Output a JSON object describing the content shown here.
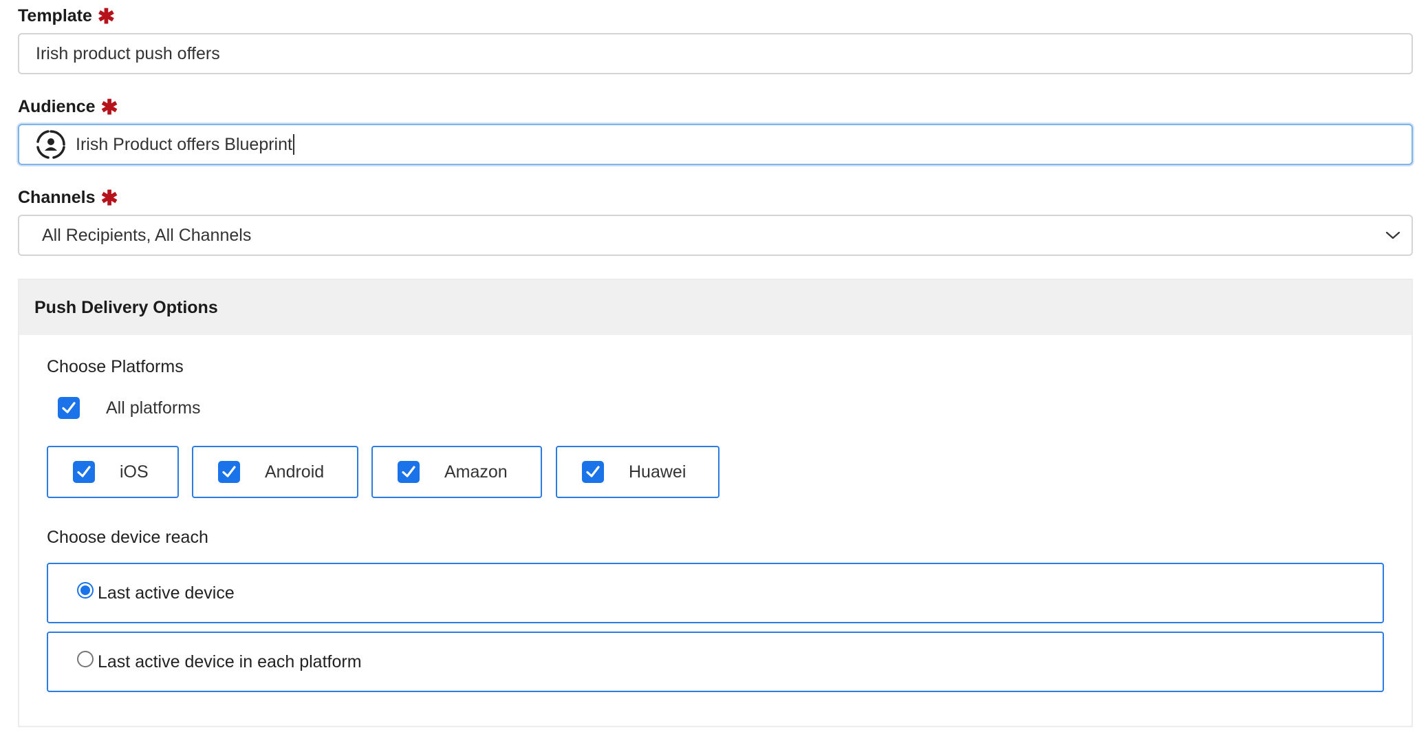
{
  "template": {
    "label": "Template",
    "required_mark": "✱",
    "value": "Irish product push offers"
  },
  "audience": {
    "label": "Audience",
    "required_mark": "✱",
    "value": "Irish Product offers Blueprint",
    "icon": "audience-segment-icon"
  },
  "channels": {
    "label": "Channels",
    "required_mark": "✱",
    "selected": "All Recipients, All Channels",
    "icon": "chevron-down-icon"
  },
  "push_delivery": {
    "title": "Push Delivery Options",
    "platforms_title": "Choose Platforms",
    "all_platforms_label": "All platforms",
    "all_platforms_checked": true,
    "platforms": [
      {
        "label": "iOS",
        "checked": true
      },
      {
        "label": "Android",
        "checked": true
      },
      {
        "label": "Amazon",
        "checked": true
      },
      {
        "label": "Huawei",
        "checked": true
      }
    ],
    "reach_title": "Choose device reach",
    "reach_options": [
      {
        "label": "Last active device",
        "selected": true
      },
      {
        "label": "Last active device in each platform",
        "selected": false
      }
    ]
  },
  "colors": {
    "accent": "#1a73e8",
    "required": "#b5121b",
    "border_blue": "#2a7be4",
    "panel_header_bg": "#f0f0f0"
  }
}
